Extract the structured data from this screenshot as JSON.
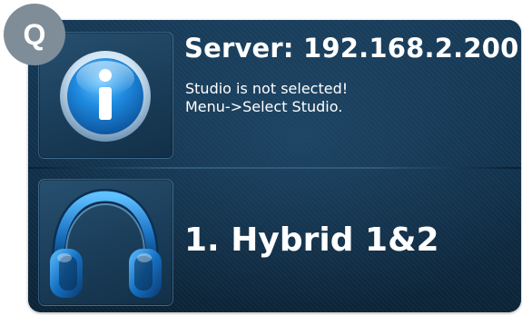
{
  "badge": {
    "label": "Q"
  },
  "server": {
    "title": "Server: 192.168.2.200",
    "message_line1": "Studio is not selected!",
    "message_line2": "Menu->Select Studio.",
    "icon": "info-icon"
  },
  "studio": {
    "name": "1. Hybrid 1&2",
    "icon": "headphones-icon"
  },
  "colors": {
    "background": "#10304b",
    "text": "#ffffff",
    "badge": "#7f8d99",
    "accent_blue": "#2a8fd8"
  }
}
